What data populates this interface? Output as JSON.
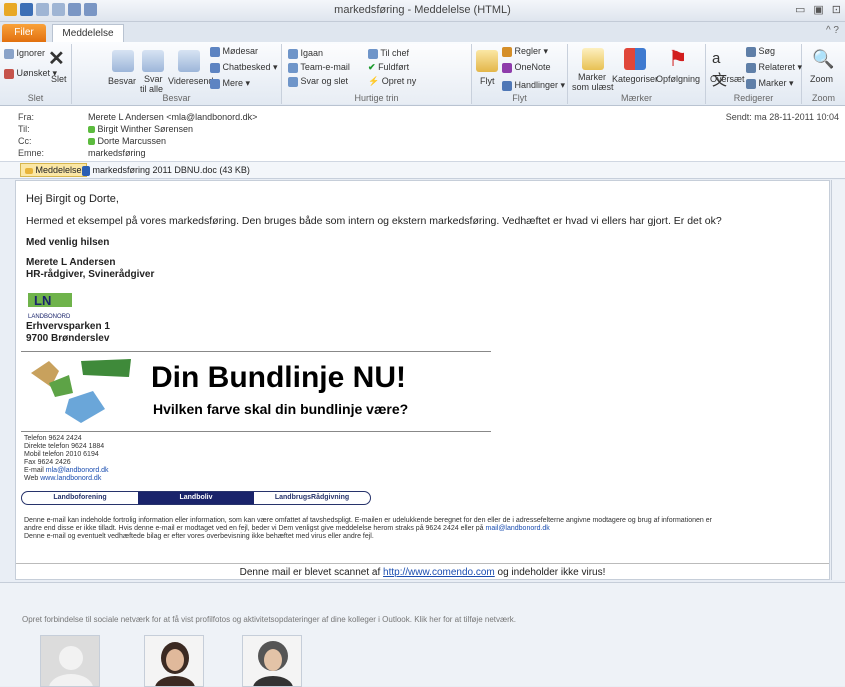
{
  "window": {
    "title": "markedsføring - Meddelelse (HTML)",
    "controls": [
      "▭",
      "▣",
      "⊡"
    ]
  },
  "tabs": {
    "file": "Filer",
    "message": "Meddelelse",
    "help_icon": "^ ?"
  },
  "ribbon": {
    "delete": {
      "ignore": "Ignorer",
      "junk": "Uønsket ▾",
      "delete": "Slet",
      "label": "Slet"
    },
    "respond": {
      "reply": "Besvar",
      "reply_all_1": "Svar",
      "reply_all_2": "til alle",
      "forward": "Videresend",
      "meeting": "Møde",
      "meeting_tail": "sar",
      "chat": "Chatbesked ▾",
      "more": "Mere ▾",
      "label": "Besvar"
    },
    "quicksteps": {
      "items": [
        "Igaan",
        "Team-e-mail",
        "Svar og slet",
        "Til chef",
        "Fuldført",
        "Opret ny"
      ],
      "label": "Hurtige trin"
    },
    "move": {
      "move": "Flyt",
      "rules": "Regler ▾",
      "onenote": "OneNote",
      "actions": "Handlinger ▾",
      "label": "Flyt"
    },
    "tags": {
      "mark_unread_1": "Marker",
      "mark_unread_2": "som ulæst",
      "categorize": "Kategoriser",
      "followup": "Opfølgning",
      "label": "Mærker"
    },
    "editing": {
      "translate": "Oversæt",
      "find": "Søg",
      "related": "Relateret ▾",
      "select": "Marker ▾",
      "label": "Redigerer"
    },
    "zoom": {
      "zoom": "Zoom",
      "label": "Zoom"
    }
  },
  "header": {
    "from_label": "Fra:",
    "from_value": "Merete L Andersen <mla@landbonord.dk>",
    "to_label": "Til:",
    "to_value": "Birgit Winther Sørensen",
    "cc_label": "Cc:",
    "cc_value": "Dorte Marcussen",
    "subject_label": "Emne:",
    "subject_value": "markedsføring",
    "sent_label": "Sendt:",
    "sent_value": "ma 28-11-2011 10:04"
  },
  "attachments": {
    "message_tab": "Meddelelse",
    "file": "markedsføring 2011 DBNU.doc (43 KB)"
  },
  "email": {
    "greeting": "Hej Birgit og Dorte,",
    "body": "Hermed et eksempel på vores markedsføring. Den bruges både som intern og ekstern markedsføring. Vedhæftet er hvad vi ellers har gjort. Er det ok?",
    "closing": "Med venlig hilsen",
    "name": "Merete L Andersen",
    "role": "HR-rådgiver, Svinerådgiver",
    "logo_text": "LANDBONORD",
    "address1": "Erhvervsparken 1",
    "address2": "9700 Brønderslev",
    "banner_title": "Din Bundlinje NU!",
    "banner_subtitle": "Hvilken farve skal din bundlinje være?",
    "contacts": [
      "Telefon 9624 2424",
      "Direkte telefon 9624 1884",
      "Mobil telefon 2010 6194",
      "Fax 9624 2426"
    ],
    "email_label": "E-mail",
    "email_link": "mla@landbonord.dk",
    "web_label": "Web",
    "web_link": "www.landbonord.dk",
    "nav": [
      "Landboforening",
      "Landboliv",
      "LandbrugsRådgivning"
    ],
    "disclaimer1": "Denne e-mail kan indeholde fortrolig information eller information, som kan være omfattet af tavshedspligt. E-mailen er udelukkende beregnet for den eller de i adressefelterne angivne modtagere og brug af informationen er",
    "disclaimer2": "andre end disse er ikke tilladt. Hvis denne e-mail er modtaget ved en fejl, beder vi Dem venligst give meddelelse herom straks på 9624 2424 eller på",
    "disclaimer2_link": "mail@landbonord.dk",
    "disclaimer3": "Denne e-mail og eventuelt vedhæftede bilag er efter vores overbevisning ikke behæftet med virus eller andre fejl.",
    "scan_pre": "Denne mail er blevet scannet af",
    "scan_link": "http://www.comendo.com",
    "scan_post": "og indeholder ikke virus!"
  },
  "social": {
    "text": "Opret forbindelse til sociale netværk for at få vist profilfotos og aktivitetsopdateringer af dine kolleger i Outlook. Klik her for at tilføje netværk."
  },
  "colors": {
    "accent": "#1a246b",
    "file_tab": "#e2700f",
    "banner_text": "#000000"
  }
}
